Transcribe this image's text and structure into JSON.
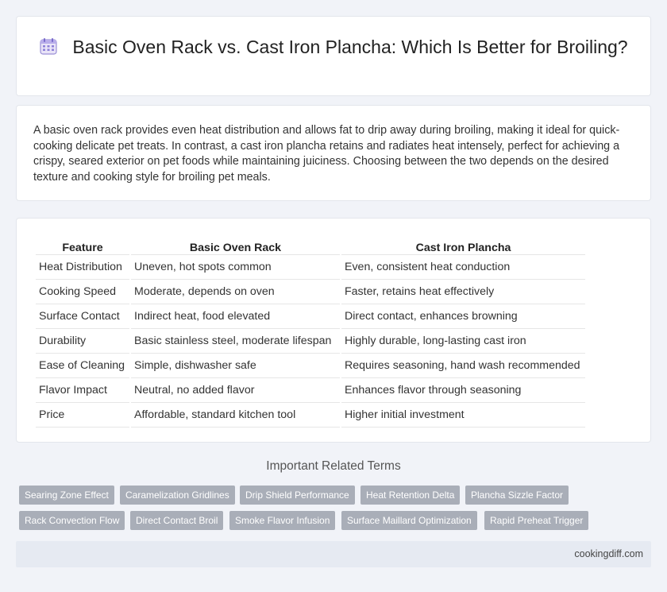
{
  "header": {
    "title": "Basic Oven Rack vs. Cast Iron Plancha: Which Is Better for Broiling?",
    "icon": "calendar-icon"
  },
  "intro": {
    "text": "A basic oven rack provides even heat distribution and allows fat to drip away during broiling, making it ideal for quick-cooking delicate pet treats. In contrast, a cast iron plancha retains and radiates heat intensely, perfect for achieving a crispy, seared exterior on pet foods while maintaining juiciness. Choosing between the two depends on the desired texture and cooking style for broiling pet meals."
  },
  "table": {
    "headers": [
      "Feature",
      "Basic Oven Rack",
      "Cast Iron Plancha"
    ],
    "rows": [
      [
        "Heat Distribution",
        "Uneven, hot spots common",
        "Even, consistent heat conduction"
      ],
      [
        "Cooking Speed",
        "Moderate, depends on oven",
        "Faster, retains heat effectively"
      ],
      [
        "Surface Contact",
        "Indirect heat, food elevated",
        "Direct contact, enhances browning"
      ],
      [
        "Durability",
        "Basic stainless steel, moderate lifespan",
        "Highly durable, long-lasting cast iron"
      ],
      [
        "Ease of Cleaning",
        "Simple, dishwasher safe",
        "Requires seasoning, hand wash recommended"
      ],
      [
        "Flavor Impact",
        "Neutral, no added flavor",
        "Enhances flavor through seasoning"
      ],
      [
        "Price",
        "Affordable, standard kitchen tool",
        "Higher initial investment"
      ]
    ]
  },
  "related": {
    "title": "Important Related Terms",
    "tags": [
      "Searing Zone Effect",
      "Caramelization Gridlines",
      "Drip Shield Performance",
      "Heat Retention Delta",
      "Plancha Sizzle Factor",
      "Rack Convection Flow",
      "Direct Contact Broil",
      "Smoke Flavor Infusion",
      "Surface Maillard Optimization",
      "Rapid Preheat Trigger"
    ]
  },
  "footer": {
    "site": "cookingdiff.com"
  },
  "colors": {
    "background": "#f1f3f8",
    "tag_bg": "#a9aeb8",
    "footer_bg": "#e6eaf2"
  }
}
